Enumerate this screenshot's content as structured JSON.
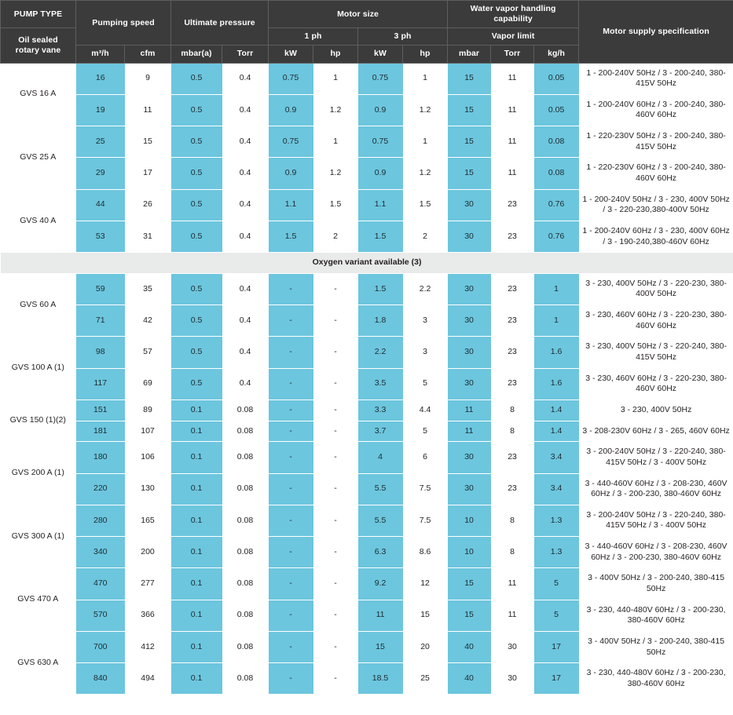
{
  "header": {
    "pump_type_label": "PUMP  TYPE",
    "pump_subtype_label": "Oil sealed\nrotary vane",
    "pumping_speed": "Pumping speed",
    "ultimate_pressure": "Ultimate pressure",
    "motor_size": "Motor size",
    "water_vapor": "Water vapor handling capability",
    "motor_supply": "Motor supply specification",
    "one_ph": "1 ph",
    "three_ph": "3 ph",
    "vapor_limit": "Vapor limit",
    "units": {
      "m3h": "m³/h",
      "cfm": "cfm",
      "mbara": "mbar(a)",
      "torr1": "Torr",
      "kw1": "kW",
      "hp1": "hp",
      "kw3": "kW",
      "hp3": "hp",
      "mbar": "mbar",
      "torr2": "Torr",
      "kgh": "kg/h"
    }
  },
  "banner": {
    "oxygen_variant": "Oxygen variant available (3)"
  },
  "colors": {
    "header_bg": "#3b3b3b",
    "accent_cyan": "#6cc6de",
    "banner_bg": "#e9eaea",
    "text": "#231f20"
  },
  "rows": [
    {
      "model": "GVS 16 A",
      "rowspan": 2,
      "group_start": true,
      "cells": [
        {
          "m3h": "16",
          "cfm": "9",
          "mbara": "0.5",
          "torr1": "0.4",
          "kw1": "0.75",
          "hp1": "1",
          "kw3": "0.75",
          "hp3": "1",
          "mbar": "15",
          "torr2": "11",
          "kgh": "0.05",
          "supply": "1 - 200-240V 50Hz / 3 - 200-240, 380-415V 50Hz"
        },
        {
          "m3h": "19",
          "cfm": "11",
          "mbara": "0.5",
          "torr1": "0.4",
          "kw1": "0.9",
          "hp1": "1.2",
          "kw3": "0.9",
          "hp3": "1.2",
          "mbar": "15",
          "torr2": "11",
          "kgh": "0.05",
          "supply": "1 - 200-240V 60Hz / 3 - 200-240, 380-460V 60Hz"
        }
      ]
    },
    {
      "model": "GVS 25 A",
      "rowspan": 2,
      "group_start": true,
      "cells": [
        {
          "m3h": "25",
          "cfm": "15",
          "mbara": "0.5",
          "torr1": "0.4",
          "kw1": "0.75",
          "hp1": "1",
          "kw3": "0.75",
          "hp3": "1",
          "mbar": "15",
          "torr2": "11",
          "kgh": "0.08",
          "supply": "1 - 220-230V 50Hz / 3 - 200-240, 380-415V 50Hz"
        },
        {
          "m3h": "29",
          "cfm": "17",
          "mbara": "0.5",
          "torr1": "0.4",
          "kw1": "0.9",
          "hp1": "1.2",
          "kw3": "0.9",
          "hp3": "1.2",
          "mbar": "15",
          "torr2": "11",
          "kgh": "0.08",
          "supply": "1 - 220-230V 60Hz / 3 - 200-240, 380-460V 60Hz"
        }
      ]
    },
    {
      "model": "GVS 40 A",
      "rowspan": 2,
      "group_start": true,
      "cells": [
        {
          "m3h": "44",
          "cfm": "26",
          "mbara": "0.5",
          "torr1": "0.4",
          "kw1": "1.1",
          "hp1": "1.5",
          "kw3": "1.1",
          "hp3": "1.5",
          "mbar": "30",
          "torr2": "23",
          "kgh": "0.76",
          "supply": "1 - 200-240V 50Hz / 3 - 230, 400V 50Hz / 3 - 220-230,380-400V 50Hz"
        },
        {
          "m3h": "53",
          "cfm": "31",
          "mbara": "0.5",
          "torr1": "0.4",
          "kw1": "1.5",
          "hp1": "2",
          "kw3": "1.5",
          "hp3": "2",
          "mbar": "30",
          "torr2": "23",
          "kgh": "0.76",
          "supply": "1 - 200-240V 60Hz / 3 - 230, 400V 60Hz / 3 - 190-240,380-460V 60Hz"
        }
      ]
    },
    {
      "model": "GVS 60 A",
      "rowspan": 2,
      "group_start": true,
      "cells": [
        {
          "m3h": "59",
          "cfm": "35",
          "mbara": "0.5",
          "torr1": "0.4",
          "kw1": "-",
          "hp1": "-",
          "kw3": "1.5",
          "hp3": "2.2",
          "mbar": "30",
          "torr2": "23",
          "kgh": "1",
          "supply": "3 - 230, 400V 50Hz / 3 - 220-230, 380-400V 50Hz"
        },
        {
          "m3h": "71",
          "cfm": "42",
          "mbara": "0.5",
          "torr1": "0.4",
          "kw1": "-",
          "hp1": "-",
          "kw3": "1.8",
          "hp3": "3",
          "mbar": "30",
          "torr2": "23",
          "kgh": "1",
          "supply": "3 - 230, 460V 60Hz / 3 - 220-230, 380-460V 60Hz"
        }
      ]
    },
    {
      "model": "GVS 100 A (1)",
      "rowspan": 2,
      "group_start": true,
      "cells": [
        {
          "m3h": "98",
          "cfm": "57",
          "mbara": "0.5",
          "torr1": "0.4",
          "kw1": "-",
          "hp1": "-",
          "kw3": "2.2",
          "hp3": "3",
          "mbar": "30",
          "torr2": "23",
          "kgh": "1.6",
          "supply": "3 - 230, 400V 50Hz / 3 - 220-240, 380-415V 50Hz"
        },
        {
          "m3h": "117",
          "cfm": "69",
          "mbara": "0.5",
          "torr1": "0.4",
          "kw1": "-",
          "hp1": "-",
          "kw3": "3.5",
          "hp3": "5",
          "mbar": "30",
          "torr2": "23",
          "kgh": "1.6",
          "supply": "3 - 230, 460V 60Hz / 3 - 220-230, 380-460V 60Hz"
        }
      ]
    },
    {
      "model": "GVS 150 (1)(2)",
      "rowspan": 2,
      "group_start": true,
      "cells": [
        {
          "m3h": "151",
          "cfm": "89",
          "mbara": "0.1",
          "torr1": "0.08",
          "kw1": "-",
          "hp1": "-",
          "kw3": "3.3",
          "hp3": "4.4",
          "mbar": "11",
          "torr2": "8",
          "kgh": "1.4",
          "supply": "3 - 230, 400V 50Hz"
        },
        {
          "m3h": "181",
          "cfm": "107",
          "mbara": "0.1",
          "torr1": "0.08",
          "kw1": "-",
          "hp1": "-",
          "kw3": "3.7",
          "hp3": "5",
          "mbar": "11",
          "torr2": "8",
          "kgh": "1.4",
          "supply": "3 - 208-230V 60Hz / 3 - 265, 460V 60Hz"
        }
      ]
    },
    {
      "model": "GVS 200 A (1)",
      "rowspan": 2,
      "group_start": true,
      "cells": [
        {
          "m3h": "180",
          "cfm": "106",
          "mbara": "0.1",
          "torr1": "0.08",
          "kw1": "-",
          "hp1": "-",
          "kw3": "4",
          "hp3": "6",
          "mbar": "30",
          "torr2": "23",
          "kgh": "3.4",
          "supply": "3 - 200-240V 50Hz / 3 - 220-240, 380-415V 50Hz / 3 - 400V 50Hz"
        },
        {
          "m3h": "220",
          "cfm": "130",
          "mbara": "0.1",
          "torr1": "0.08",
          "kw1": "-",
          "hp1": "-",
          "kw3": "5.5",
          "hp3": "7.5",
          "mbar": "30",
          "torr2": "23",
          "kgh": "3.4",
          "supply": "3 - 440-460V 60Hz / 3 - 208-230, 460V 60Hz / 3 - 200-230, 380-460V 60Hz"
        }
      ]
    },
    {
      "model": "GVS 300 A (1)",
      "rowspan": 2,
      "group_start": true,
      "cells": [
        {
          "m3h": "280",
          "cfm": "165",
          "mbara": "0.1",
          "torr1": "0.08",
          "kw1": "-",
          "hp1": "-",
          "kw3": "5.5",
          "hp3": "7.5",
          "mbar": "10",
          "torr2": "8",
          "kgh": "1.3",
          "supply": "3 - 200-240V 50Hz / 3 - 220-240, 380-415V 50Hz / 3 - 400V 50Hz"
        },
        {
          "m3h": "340",
          "cfm": "200",
          "mbara": "0.1",
          "torr1": "0.08",
          "kw1": "-",
          "hp1": "-",
          "kw3": "6.3",
          "hp3": "8.6",
          "mbar": "10",
          "torr2": "8",
          "kgh": "1.3",
          "supply": "3 - 440-460V 60Hz / 3 - 208-230, 460V 60Hz / 3 - 200-230, 380-460V 60Hz"
        }
      ]
    },
    {
      "model": "GVS 470 A",
      "rowspan": 2,
      "group_start": true,
      "cells": [
        {
          "m3h": "470",
          "cfm": "277",
          "mbara": "0.1",
          "torr1": "0.08",
          "kw1": "-",
          "hp1": "-",
          "kw3": "9.2",
          "hp3": "12",
          "mbar": "15",
          "torr2": "11",
          "kgh": "5",
          "supply": "3 - 400V 50Hz / 3 - 200-240, 380-415 50Hz"
        },
        {
          "m3h": "570",
          "cfm": "366",
          "mbara": "0.1",
          "torr1": "0.08",
          "kw1": "-",
          "hp1": "-",
          "kw3": "11",
          "hp3": "15",
          "mbar": "15",
          "torr2": "11",
          "kgh": "5",
          "supply": "3 - 230, 440-480V 60Hz / 3 - 200-230, 380-460V 60Hz"
        }
      ]
    },
    {
      "model": "GVS 630 A",
      "rowspan": 2,
      "group_start": true,
      "cells": [
        {
          "m3h": "700",
          "cfm": "412",
          "mbara": "0.1",
          "torr1": "0.08",
          "kw1": "-",
          "hp1": "-",
          "kw3": "15",
          "hp3": "20",
          "mbar": "40",
          "torr2": "30",
          "kgh": "17",
          "supply": "3 - 400V 50Hz / 3 - 200-240, 380-415 50Hz"
        },
        {
          "m3h": "840",
          "cfm": "494",
          "mbara": "0.1",
          "torr1": "0.08",
          "kw1": "-",
          "hp1": "-",
          "kw3": "18.5",
          "hp3": "25",
          "mbar": "40",
          "torr2": "30",
          "kgh": "17",
          "supply": "3 - 230, 440-480V 60Hz / 3 - 200-230, 380-460V 60Hz"
        }
      ]
    }
  ],
  "banner_after_group_index": 2
}
